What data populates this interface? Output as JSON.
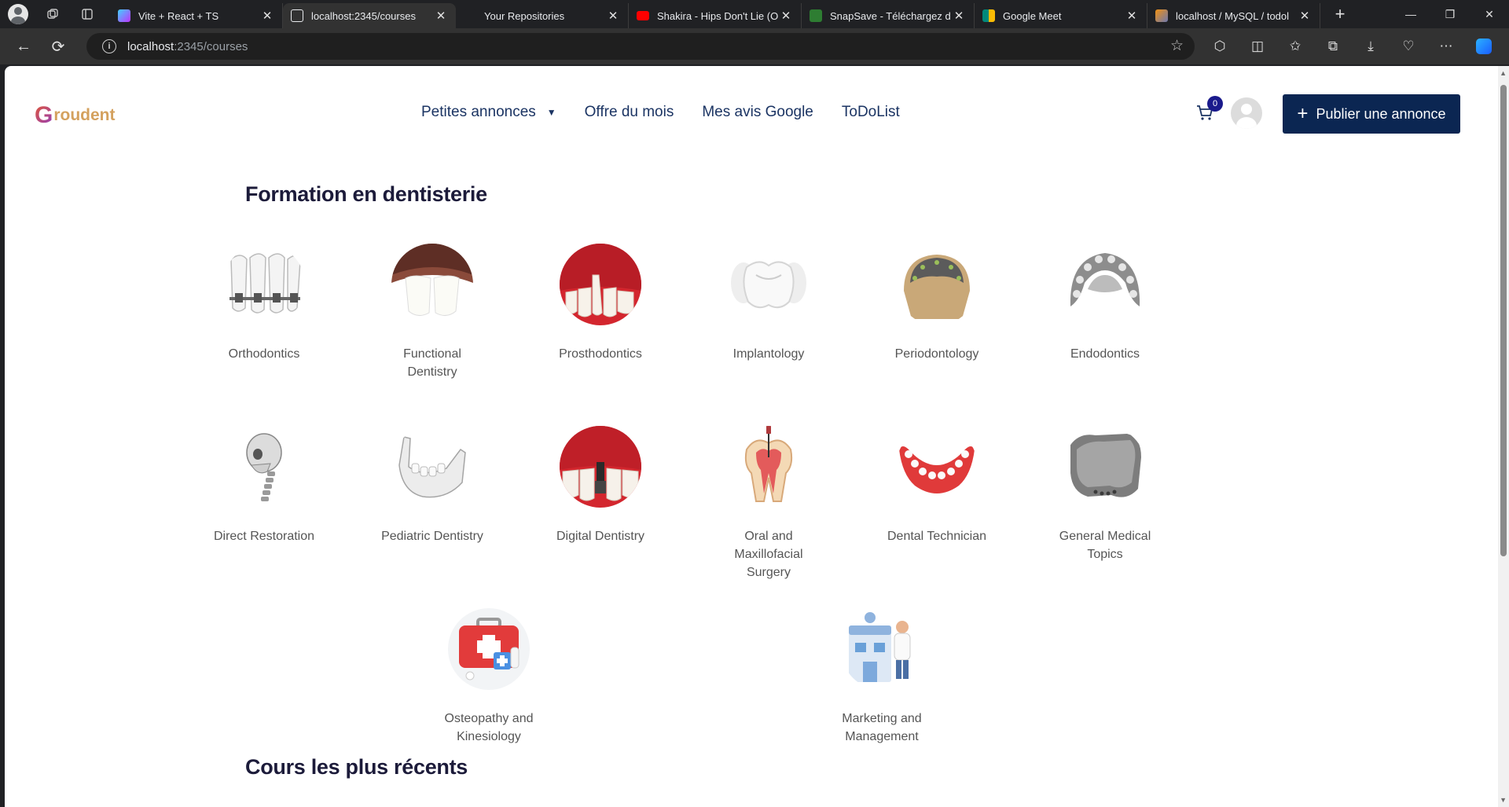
{
  "browser": {
    "tabs": [
      {
        "label": "Vite + React + TS",
        "favicon_color": "#8b5cf6"
      },
      {
        "label": "localhost:2345/courses",
        "favicon_color": "#e8eaed",
        "active": true
      },
      {
        "label": "Your Repositories",
        "favicon_color": "#202124"
      },
      {
        "label": "Shakira - Hips Don't Lie (O",
        "favicon_color": "#ff0000"
      },
      {
        "label": "SnapSave - Téléchargez d",
        "favicon_color": "#2e7d32"
      },
      {
        "label": "Google Meet",
        "favicon_color": "#00897b"
      },
      {
        "label": "localhost / MySQL / todol",
        "favicon_color": "#f29111"
      }
    ],
    "url_host": "localhost",
    "url_path": ":2345/courses"
  },
  "header": {
    "logo_first": "G",
    "logo_rest": "roudent",
    "nav": [
      "Petites annonces",
      "Offre du mois",
      "Mes avis Google",
      "ToDoList"
    ],
    "cart_count": "0",
    "publish_label": "Publier une annonce"
  },
  "sections": {
    "formation_title": "Formation en dentisterie",
    "recent_title": "Cours les plus récents"
  },
  "courses": [
    {
      "label": "Orthodontics",
      "icon": "braces-teeth"
    },
    {
      "label": "Functional Dentistry",
      "icon": "front-teeth"
    },
    {
      "label": "Prosthodontics",
      "icon": "gum-teeth"
    },
    {
      "label": "Implantology",
      "icon": "molar"
    },
    {
      "label": "Periodontology",
      "icon": "dental-model"
    },
    {
      "label": "Endodontics",
      "icon": "upper-arch"
    },
    {
      "label": "Direct Restoration",
      "icon": "skull"
    },
    {
      "label": "Pediatric Dentistry",
      "icon": "jaw"
    },
    {
      "label": "Digital Dentistry",
      "icon": "implant-gum"
    },
    {
      "label": "Oral and Maxillofacial Surgery",
      "icon": "tooth-cross-section"
    },
    {
      "label": "Dental Technician",
      "icon": "denture"
    },
    {
      "label": "General Medical Topics",
      "icon": "scanned-jaw"
    },
    {
      "label": "Osteopathy and Kinesiology",
      "icon": "first-aid-kit"
    },
    {
      "label": "Marketing and Management",
      "icon": "clinic-doctor"
    }
  ]
}
